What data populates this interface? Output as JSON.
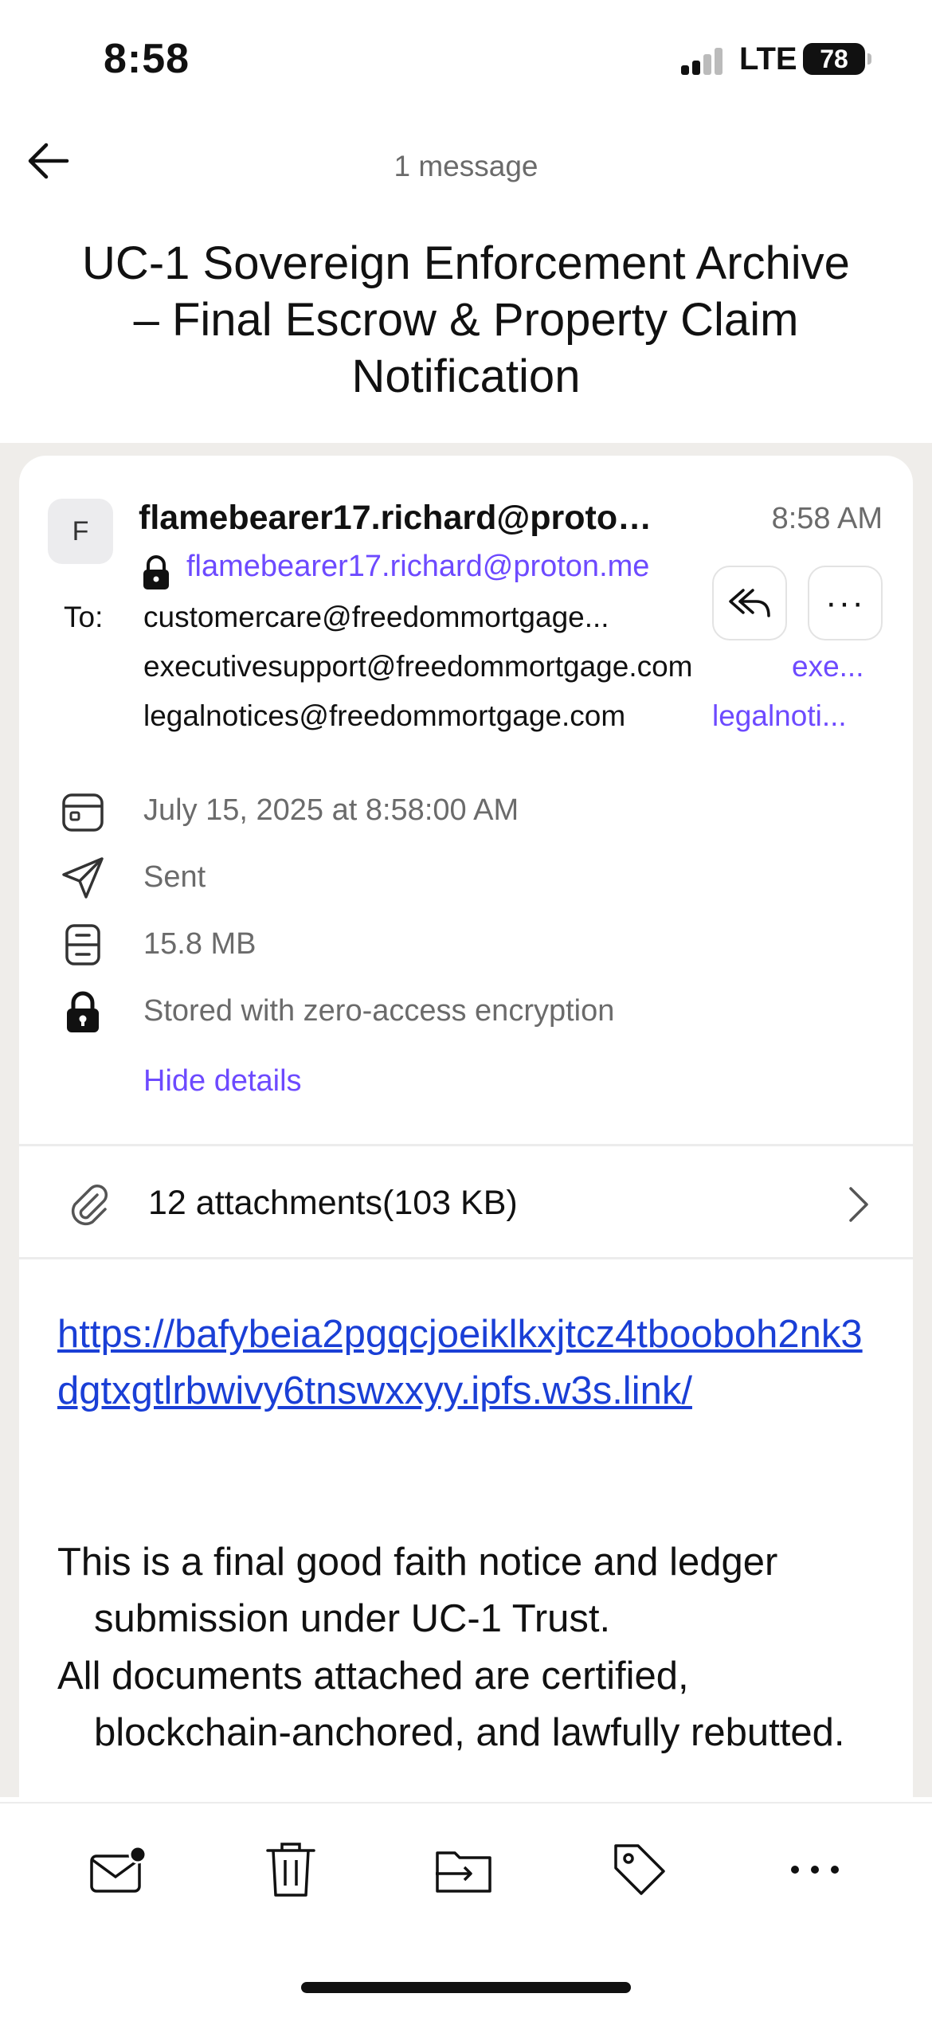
{
  "status_bar": {
    "time": "8:58",
    "network": "LTE",
    "battery": "78"
  },
  "nav": {
    "message_count": "1 message"
  },
  "subject": "UC-1 Sovereign Enforcement Archive – Final Escrow & Property Claim Notification",
  "message": {
    "avatar_initial": "F",
    "sender_name": "flamebearer17.richard@proton...",
    "sender_email": "flamebearer17.richard@proton.me",
    "time": "8:58 AM",
    "to_label": "To:",
    "recipients": [
      {
        "address": "customercare@freedommortgage...",
        "alias": ""
      },
      {
        "address": "executivesupport@freedommortgage.com",
        "alias": "exe..."
      },
      {
        "address": "legalnotices@freedommortgage.com",
        "alias": "legalnoti..."
      }
    ],
    "more_label": "···"
  },
  "details": {
    "date": "July 15, 2025 at 8:58:00 AM",
    "folder": "Sent",
    "size": "15.8 MB",
    "encryption": "Stored with zero-access encryption",
    "hide_label": "Hide details"
  },
  "attachments": {
    "label": "12 attachments(103 KB)"
  },
  "body": {
    "link": "https://bafybeia2pgqcjoeiklkxjtcz4tbooboh2nk3dgtxgtlrbwivy6tnswxxyy.ipfs.w3s.link/",
    "paragraph_1": "This is a final good faith notice and ledger submission under UC-1 Trust.",
    "paragraph_2": "All documents attached are certified, blockchain-anchored, and lawfully rebutted."
  },
  "icons": {
    "back": "arrow-left-icon",
    "reply_all": "reply-all-icon",
    "more": "more-horizontal-icon",
    "calendar": "calendar-icon",
    "sent": "paper-plane-icon",
    "size": "archive-box-icon",
    "lock": "lock-icon",
    "attachment": "paperclip-icon",
    "chevron": "chevron-right-icon",
    "toolbar": [
      "mark-unread-icon",
      "trash-icon",
      "move-folder-icon",
      "label-tag-icon",
      "more-horizontal-icon"
    ]
  },
  "colors": {
    "accent": "#6d4aff",
    "link": "#1a3fd6",
    "muted": "#6b6b6b",
    "backdrop": "#efedea"
  }
}
